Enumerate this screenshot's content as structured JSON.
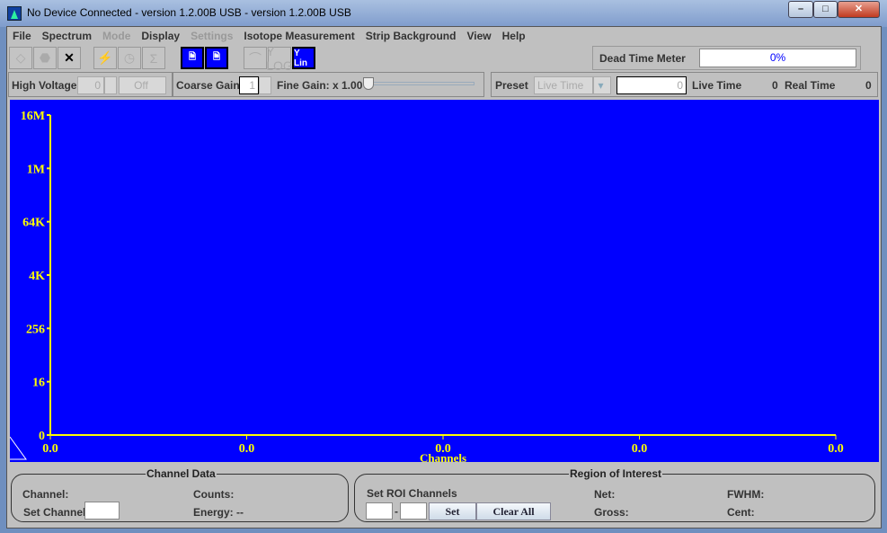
{
  "window": {
    "title": "No Device Connected  - version 1.2.00B USB  - version 1.2.00B USB",
    "minimize": "–",
    "maximize": "□",
    "close": "✕"
  },
  "menu": [
    {
      "label": "File",
      "enabled": true
    },
    {
      "label": "Spectrum",
      "enabled": true
    },
    {
      "label": "Mode",
      "enabled": false
    },
    {
      "label": "Display",
      "enabled": true
    },
    {
      "label": "Settings",
      "enabled": false
    },
    {
      "label": "Isotope Measurement",
      "enabled": true
    },
    {
      "label": "Strip Background",
      "enabled": true
    },
    {
      "label": "View",
      "enabled": true
    },
    {
      "label": "Help",
      "enabled": true
    }
  ],
  "toolbar": {
    "buttons": [
      {
        "icon": "diamond-icon",
        "glyph": "◇"
      },
      {
        "icon": "octagon-icon",
        "glyph": "⬣"
      },
      {
        "icon": "close-icon",
        "glyph": "✕"
      },
      {
        "icon": "lightning-icon",
        "glyph": "⚡"
      },
      {
        "icon": "clock-icon",
        "glyph": "◷"
      },
      {
        "icon": "sigma-icon",
        "glyph": "Σ"
      },
      {
        "icon": "document-icon",
        "glyph": "🗎"
      },
      {
        "icon": "document-dfl-icon",
        "glyph": "🗎"
      },
      {
        "icon": "peak-icon",
        "glyph": "⌒"
      },
      {
        "icon": "y-log-icon",
        "glyph": "Y LOG"
      },
      {
        "icon": "y-lin-icon",
        "glyph": "Y Lin"
      }
    ]
  },
  "dead_time": {
    "label": "Dead Time Meter",
    "value": "0%",
    "color": "#0000ff"
  },
  "controls": {
    "high_voltage_label": "High Voltage",
    "high_voltage_value": "0",
    "hv_toggle": "Off",
    "coarse_gain_label": "Coarse Gain",
    "coarse_gain_value": "1",
    "fine_gain_label": "Fine Gain: x 1.00",
    "fine_gain_slider": 0,
    "preset_label": "Preset",
    "preset_value": "Live Time",
    "preset_input": "0",
    "live_time_label": "Live Time",
    "live_time_value": "0",
    "real_time_label": "Real Time",
    "real_time_value": "0"
  },
  "chart_data": {
    "type": "line",
    "background": "#0000ff",
    "axis_color": "#ffff00",
    "xlabel": "Channels",
    "ylabel": "",
    "y_scale": "log",
    "y_ticks": [
      "16M",
      "1M",
      "64K",
      "4K",
      "256",
      "16",
      "0"
    ],
    "x_ticks": [
      "0.0",
      "0.0",
      "0.0",
      "0.0",
      "0.0"
    ],
    "series": []
  },
  "channel_data": {
    "title": "Channel Data",
    "channel_label": "Channel:",
    "counts_label": "Counts:",
    "set_channel_label": "Set Channel",
    "set_channel_value": "",
    "energy_label": "Energy: --"
  },
  "roi": {
    "title": "Region of Interest",
    "set_roi_label": "Set ROI Channels",
    "from": "",
    "dash": "-",
    "to": "",
    "set_button": "Set",
    "clear_button": "Clear All",
    "net_label": "Net:",
    "gross_label": "Gross:",
    "fwhm_label": "FWHM:",
    "cent_label": "Cent:"
  }
}
